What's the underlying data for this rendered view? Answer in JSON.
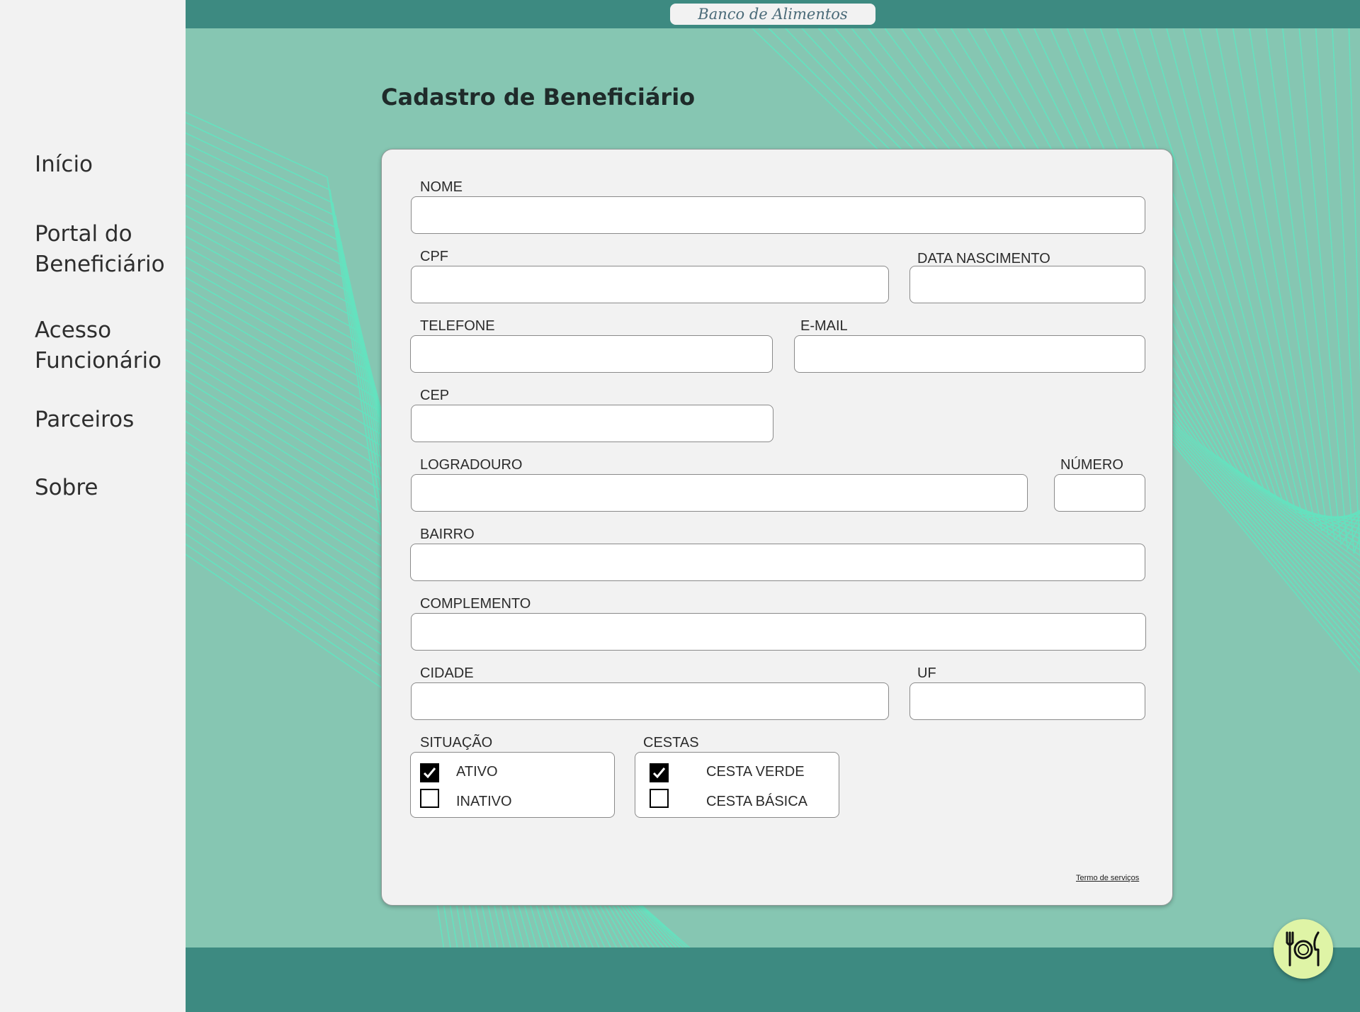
{
  "site": {
    "title": "Banco de Alimentos"
  },
  "sidebar": {
    "items": [
      {
        "label": "Início"
      },
      {
        "label_line1": "Portal do",
        "label_line2": "Beneficiário"
      },
      {
        "label_line1": "Acesso",
        "label_line2": "Funcionário"
      },
      {
        "label": "Parceiros"
      },
      {
        "label": "Sobre"
      }
    ]
  },
  "page": {
    "title": "Cadastro de Beneficiário"
  },
  "form": {
    "nome": {
      "label": "NOME",
      "value": ""
    },
    "cpf": {
      "label": "CPF",
      "value": ""
    },
    "data_nascimento": {
      "label": "DATA NASCIMENTO",
      "value": ""
    },
    "telefone": {
      "label": "TELEFONE",
      "value": ""
    },
    "email": {
      "label": "E-MAIL",
      "value": ""
    },
    "cep": {
      "label": "CEP",
      "value": ""
    },
    "logradouro": {
      "label": "LOGRADOURO",
      "value": ""
    },
    "numero": {
      "label": "NÚMERO",
      "value": ""
    },
    "bairro": {
      "label": "BAIRRO",
      "value": ""
    },
    "complemento": {
      "label": "COMPLEMENTO",
      "value": ""
    },
    "cidade": {
      "label": "CIDADE",
      "value": ""
    },
    "uf": {
      "label": "UF",
      "value": ""
    },
    "situacao": {
      "label": "SITUAÇÃO",
      "options": [
        {
          "label": "ATIVO",
          "checked": true
        },
        {
          "label": "INATIVO",
          "checked": false
        }
      ]
    },
    "cestas": {
      "label": "CESTAS",
      "options": [
        {
          "label": "CESTA VERDE",
          "checked": true
        },
        {
          "label": "CESTA BÁSICA",
          "checked": false
        }
      ]
    },
    "terms_link": "Termo de serviços"
  },
  "colors": {
    "header": "#3d8a81",
    "background": "#86c6b2",
    "pattern_lines": "#5fe8c2",
    "card": "#f2f2f2",
    "fab": "#dff4a6"
  },
  "icons": {
    "fab": "plate-fork-knife-icon",
    "check": "checkmark-icon"
  }
}
